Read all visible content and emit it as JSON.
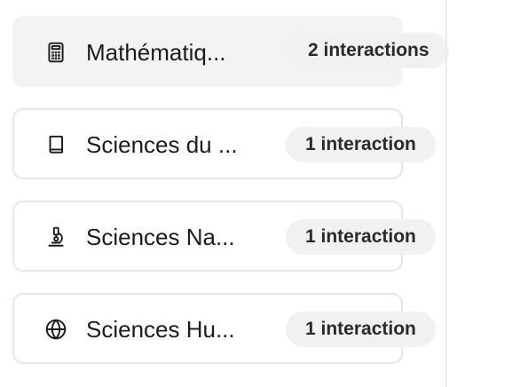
{
  "subjects": [
    {
      "label": "Mathématiq...",
      "count": "2 interactions",
      "icon": "calculator-icon",
      "active": true
    },
    {
      "label": "Sciences du ...",
      "count": "1 interaction",
      "icon": "book-icon",
      "active": false
    },
    {
      "label": "Sciences Na...",
      "count": "1 interaction",
      "icon": "microscope-icon",
      "active": false
    },
    {
      "label": "Sciences Hu...",
      "count": "1 interaction",
      "icon": "globe-icon",
      "active": false
    }
  ],
  "colors": {
    "active_background": "#f3f3f2",
    "border": "#e6e6e6",
    "pill_background": "#f1f1ef",
    "text": "#1c1c1c"
  }
}
